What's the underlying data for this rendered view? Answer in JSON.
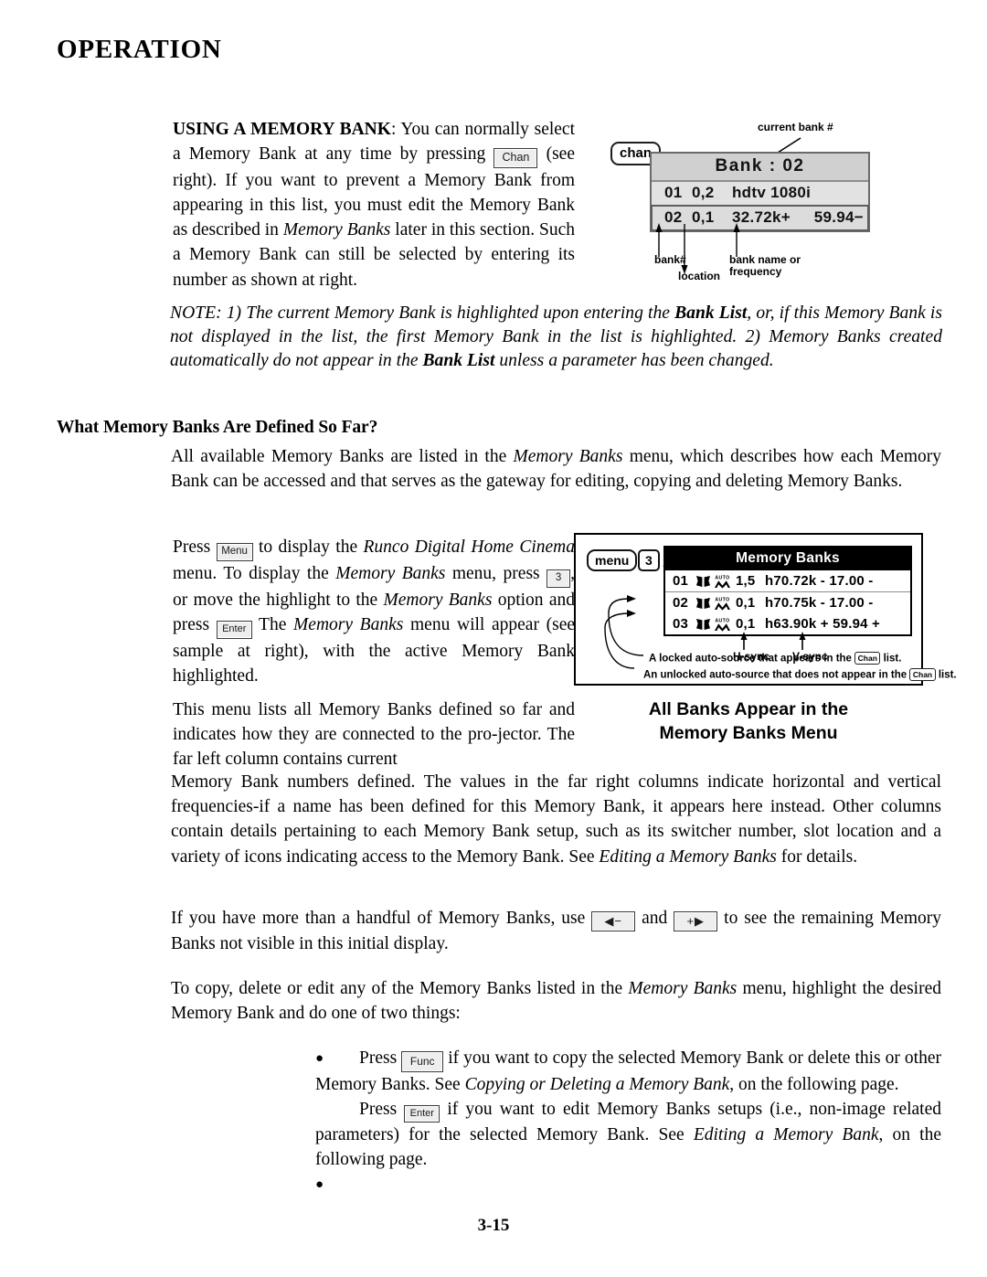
{
  "page": {
    "chapter_title": "OPERATION",
    "folio": "3-15"
  },
  "body": {
    "p_using_bank": {
      "lead": "USING A MEMORY BANK",
      "t1": ": You can normally select a Memory Bank at any time by pressing ",
      "key1": "Chan",
      "t2": " (see right). If you want to prevent a Memory Bank from appearing in this list, you must edit the Memory Bank as described in ",
      "em1": "Memory Banks",
      "t3": " later in this section. Such a Memory Bank can still be selected by entering its number as shown at right."
    },
    "note": {
      "t1": "NOTE: 1) The current Memory Bank is highlighted upon entering the ",
      "b1": "Bank List",
      "t2": ", or, if this Memory Bank is not displayed in the list, the first Memory Bank in the list is highlighted. 2) Memory Banks created automatically do not appear in the ",
      "b2": "Bank List",
      "t3": " unless a parameter has been changed."
    },
    "subhead_defined": "What Memory Banks Are Defined So Far?",
    "p_all_available": {
      "t1": "All available Memory Banks are listed in the ",
      "em1": "Memory Banks",
      "t2": " menu, which describes how each Memory Bank can be accessed and that serves as the gateway for editing, copying and deleting Memory Banks."
    },
    "p_press_menu": {
      "t1": "Press ",
      "key_menu": "Menu",
      "t2": " to display the ",
      "em1": "Runco Digital Home Cinema",
      "t3": " menu. To display the ",
      "em2": "Memory Banks",
      "t4": " menu, press ",
      "key_num": "3",
      "t5": ", or move the highlight to the ",
      "em3": "Memory Banks",
      "t6": " option and press ",
      "key_enter": "Enter",
      "t7": " The ",
      "em4": "Memory Banks",
      "t8": " menu will appear (see sample at right), with the active Memory Bank highlighted."
    },
    "p_this_menu_col": "This menu lists all Memory Banks defined so far and indicates how they are connected to the pro-jector. The far left column contains current",
    "p_this_menu_full": {
      "t1": "Memory Bank numbers defined. The values in the far right columns indicate horizontal and vertical frequencies-if a name has been defined for this Memory Bank, it appears here instead. Other columns contain details pertaining to each Memory Bank setup, such as its switcher number, slot location and a variety of icons indicating access to the Memory Bank. See ",
      "em1": "Editing a Memory Banks",
      "t2": " for details."
    },
    "p_handful": {
      "t1": "If you have more than a handful of Memory Banks, use ",
      "key_left": "◀−",
      "t2": " and ",
      "key_right": "+▶",
      "t3": " to see the remaining Memory Banks not visible in this initial display."
    },
    "p_to_copy": {
      "t1": "To copy, delete or edit any of the Memory Banks listed in the ",
      "em1": "Memory Banks",
      "t2": " menu, highlight the desired Memory Bank and do one of two things:"
    },
    "bullets": [
      {
        "dot": "●",
        "t1": "Press ",
        "key": "Func",
        "t2": " if you want to copy the selected Memory Bank or delete this or other Memory Banks. See ",
        "em1": "Copying or Deleting a Memory Bank",
        "t3": ", on the following page."
      },
      {
        "dot": "●",
        "t1": "Press ",
        "key": "Enter",
        "t2": " if you want to edit Memory Banks setups (i.e., non-image related parameters) for the selected Memory Bank. See ",
        "em1": "Editing a Memory Bank",
        "t3": ", on the following page."
      }
    ]
  },
  "figure_bank": {
    "chan_key": "chan",
    "title": "Bank :  02",
    "rows": [
      {
        "num": "01",
        "loc": "0,2",
        "name": "hdtv 1080i",
        "extra": "",
        "selected": false
      },
      {
        "num": "02",
        "loc": "0,1",
        "name": "32.72k+",
        "extra": "59.94−",
        "selected": true
      }
    ],
    "callouts": {
      "current_bank": "current bank #",
      "bank_num": "bank#",
      "location": "location",
      "name_or_freq_l1": "bank name or",
      "name_or_freq_l2": "frequency"
    }
  },
  "figure_menu": {
    "menu_key": "menu",
    "num_key": "3",
    "arrow": "→",
    "panel_title": "Memory Banks",
    "rows": [
      {
        "num": "01",
        "loc": "1,5",
        "freq": "h70.72k -  17.00 -",
        "highlighted": true
      },
      {
        "num": "02",
        "loc": "0,1",
        "freq": "h70.75k -  17.00 -",
        "highlighted": false
      },
      {
        "num": "03",
        "loc": "0,1",
        "freq": "h63.90k + 59.94 +",
        "highlighted": false
      }
    ],
    "icon_book": "book-icon",
    "icon_auto": "auto-waveform-icon",
    "icon_auto_label": "AUTO",
    "hsync_label": "H-sync",
    "vsync_label": "V-sync",
    "caption_locked_a": "A locked auto-source that appears in the ",
    "caption_locked_key": "Chan",
    "caption_locked_b": " list.",
    "caption_unlocked_a": "An unlocked auto-source that does not appear in the ",
    "caption_unlocked_key": "Chan",
    "caption_unlocked_b": " list."
  },
  "figure_caption": {
    "line1": "All Banks Appear in the",
    "line2": "Memory Banks Menu"
  },
  "colors": {
    "ink": "#000000",
    "paper": "#ffffff",
    "osd_bg": "#d8d8d8",
    "osd_border": "#6b6b6b",
    "menu_head_bg": "#000000",
    "menu_head_fg": "#ffffff"
  }
}
